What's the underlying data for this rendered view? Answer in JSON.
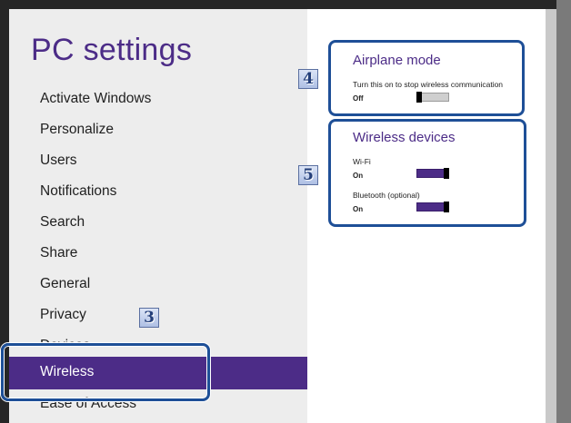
{
  "left_nav": {
    "title": "PC settings",
    "items": [
      {
        "label": "Activate Windows"
      },
      {
        "label": "Personalize"
      },
      {
        "label": "Users"
      },
      {
        "label": "Notifications"
      },
      {
        "label": "Search"
      },
      {
        "label": "Share"
      },
      {
        "label": "General"
      },
      {
        "label": "Privacy"
      },
      {
        "label": "Devices"
      },
      {
        "label": "Wireless",
        "selected": true
      },
      {
        "label": "Ease of Access"
      }
    ]
  },
  "airplane_mode": {
    "title": "Airplane mode",
    "description": "Turn this on to stop wireless communication",
    "state_label": "Off",
    "on": false
  },
  "wireless_devices": {
    "title": "Wireless devices",
    "wifi": {
      "label": "Wi-Fi",
      "state_label": "On",
      "on": true
    },
    "bluetooth": {
      "label": "Bluetooth (optional)",
      "state_label": "On",
      "on": true
    }
  },
  "callouts": {
    "badge_3": "3",
    "badge_4": "4",
    "badge_5": "5"
  },
  "colors": {
    "accent": "#4c2c87",
    "callout_border": "#1e4f97",
    "left_pane_bg": "#ededed"
  }
}
